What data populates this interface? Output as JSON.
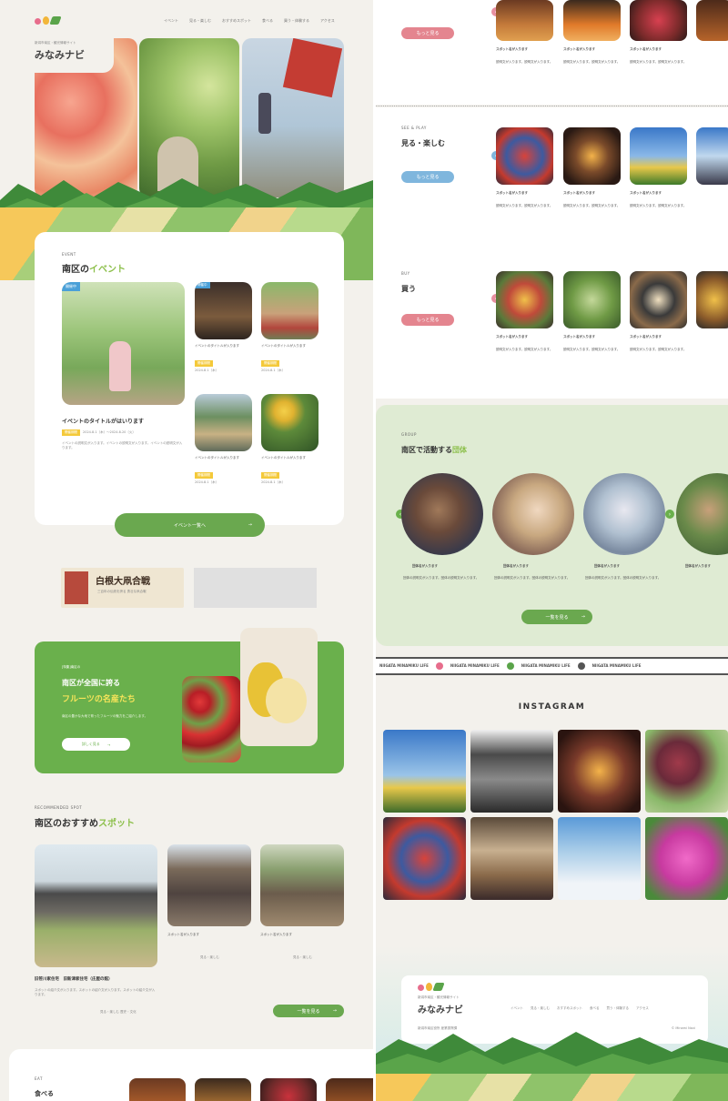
{
  "header": {
    "logo_tagline": "新潟市南区・観光情報サイト",
    "logo_title": "みなみナビ",
    "nav": [
      "イベント",
      "見る・楽しむ",
      "おすすめスポット",
      "食べる",
      "買う・体験する",
      "アクセス"
    ]
  },
  "events": {
    "section_en": "EVENT",
    "title_pre": "南区の",
    "title_hl": "イベント",
    "badge": "開催中",
    "feature_title": "イベントのタイトルがはいります",
    "feature_tag": "開催期間",
    "feature_date": "2024.8.1（木）〜2024.8.20（火）",
    "feature_desc": "イベントの説明文が入ります。イベントの説明文が入ります。イベントの説明文が入ります。",
    "small": [
      {
        "title": "イベントのタイトルが入ります",
        "tag": "開催期間",
        "date": "2024.8.1（木）"
      },
      {
        "title": "イベントのタイトルが入ります",
        "tag": "開催期間",
        "date": "2024.8.1（木）"
      },
      {
        "title": "イベントのタイトルが入ります",
        "tag": "開催期間",
        "date": "2024.8.1（木）"
      },
      {
        "title": "イベントのタイトルが入ります",
        "tag": "開催期間",
        "date": "2024.8.1（木）"
      }
    ],
    "more_label": "イベント一覧へ"
  },
  "banner": {
    "title": "白根大凧合戦",
    "subtitle": "三百年の伝統を誇る 勇壮な凧合戦"
  },
  "fruits": {
    "kicker": "[特集]南区の",
    "line1": "南区が全国に誇る",
    "line2": "フルーツの名産たち",
    "desc": "南区の豊かな大地で育ったフルーツの魅力をご紹介します。",
    "btn": "詳しく見る"
  },
  "spots": {
    "section_en": "RECOMMENDED SPOT",
    "title_pre": "南区のおすすめ",
    "title_hl": "スポット",
    "main_name": "旧笹川家住宅　旧新津家住宅（庄屋の館）",
    "main_desc": "スポットの紹介文が入ります。スポットの紹介文が入ります。スポットの紹介文が入ります。",
    "main_tag": "見る・楽しむ 歴史・文化",
    "sub": [
      {
        "name": "スポット名が入ります",
        "tag": "見る・楽しむ"
      },
      {
        "name": "スポット名が入ります",
        "tag": "見る・楽しむ"
      }
    ],
    "more_label": "一覧を見る"
  },
  "eat": {
    "section_en": "EAT",
    "title": "食べる"
  },
  "categories": {
    "see": {
      "en": "SEE & PLAY",
      "title": "見る・楽しむ",
      "btn": "もっと見る"
    },
    "buy": {
      "en": "BUY",
      "title": "買う",
      "btn": "もっと見る"
    },
    "eat_btn": "もっと見る",
    "card_title": "スポット名が入ります",
    "card_desc": "説明文が入ります。説明文が入ります。"
  },
  "groups": {
    "section_en": "GROUP",
    "title_pre": "南区で活動する",
    "title_hl": "団体",
    "names": [
      "団体名が入ります",
      "団体名が入ります",
      "団体名が入ります",
      "団体名が入ります"
    ],
    "desc": "団体の説明文が入ります。団体の説明文が入ります。",
    "btn": "一覧を見る"
  },
  "ticker": [
    "NIIGATA MINAMIKU LIFE",
    "NIIGATA MINAMIKU LIFE",
    "NIIGATA MINAMIKU LIFE",
    "NIIGATA MINAMIKU LIFE"
  ],
  "instagram": {
    "title": "INSTAGRAM"
  },
  "footer": {
    "tagline": "新潟市南区・観光情報サイト",
    "title": "みなみナビ",
    "nav": [
      "イベント",
      "見る・楽しむ",
      "おすすめスポット",
      "食べる",
      "買う・体験する",
      "アクセス"
    ],
    "address": "新潟市南区役所 産業振興課",
    "copyright": "© Minami Navi"
  }
}
